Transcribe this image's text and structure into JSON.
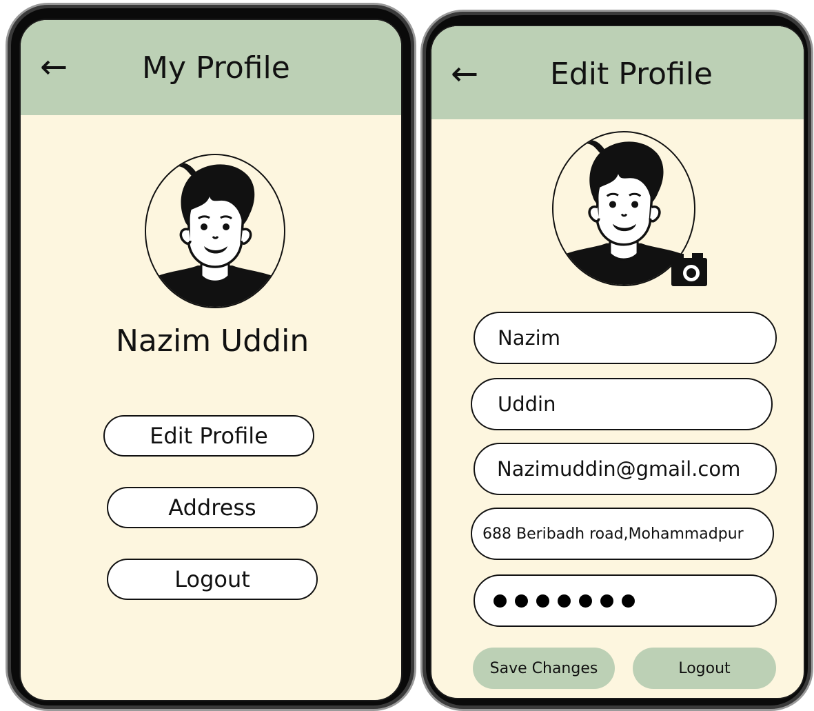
{
  "profile_screen": {
    "back_icon": "arrow-left-icon",
    "title": "My Profile",
    "avatar_icon": "user-avatar-icon",
    "user_name": "Nazim Uddin",
    "buttons": {
      "edit_profile": "Edit Profile",
      "address": "Address",
      "logout": "Logout"
    }
  },
  "edit_screen": {
    "back_icon": "arrow-left-icon",
    "title": "Edit Profile",
    "avatar_icon": "user-avatar-icon",
    "camera_icon": "camera-icon",
    "fields": {
      "first_name": "Nazim",
      "last_name": "Uddin",
      "email": "Nazimuddin@gmail.com",
      "address": "688 Beribadh road,Mohammadpur",
      "password_length": 7
    },
    "buttons": {
      "save_changes": "Save Changes",
      "logout": "Logout"
    }
  },
  "colors": {
    "header_green": "#bcd0b5",
    "screen_cream": "#fdf6df",
    "outline": "#111111"
  }
}
